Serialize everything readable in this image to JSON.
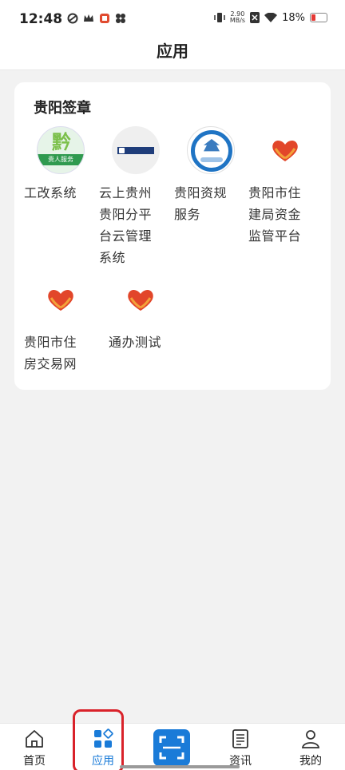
{
  "status_bar": {
    "time": "12:48",
    "net_speed_value": "2.90",
    "net_speed_unit": "MB/s",
    "battery": "18%"
  },
  "header": {
    "title": "应用"
  },
  "section": {
    "title": "贵阳签章",
    "apps": [
      {
        "label": "工改系统",
        "icon": "qian-ren-service-icon",
        "logo_text": "黔",
        "logo_sub": "贵人服务"
      },
      {
        "label": "云上贵州贵阳分平台云管理系统",
        "icon": "cloud-guizhou-icon"
      },
      {
        "label": "贵阳资规服务",
        "icon": "guiyang-planning-icon"
      },
      {
        "label": "贵阳市住建局资金监管平台",
        "icon": "heart-hands-icon"
      },
      {
        "label": "贵阳市住房交易网",
        "icon": "heart-hands-icon"
      },
      {
        "label": "通办测试",
        "icon": "heart-hands-icon"
      }
    ]
  },
  "bottom_nav": {
    "items": [
      {
        "label": "首页",
        "icon": "home-icon",
        "active": false
      },
      {
        "label": "应用",
        "icon": "apps-grid-icon",
        "active": true
      },
      {
        "label": "",
        "icon": "scan-icon",
        "active": false
      },
      {
        "label": "资讯",
        "icon": "news-icon",
        "active": false
      },
      {
        "label": "我的",
        "icon": "profile-icon",
        "active": false
      }
    ]
  },
  "colors": {
    "accent": "#1a7bd8",
    "highlight": "#d9222a",
    "background": "#f2f2f2"
  }
}
